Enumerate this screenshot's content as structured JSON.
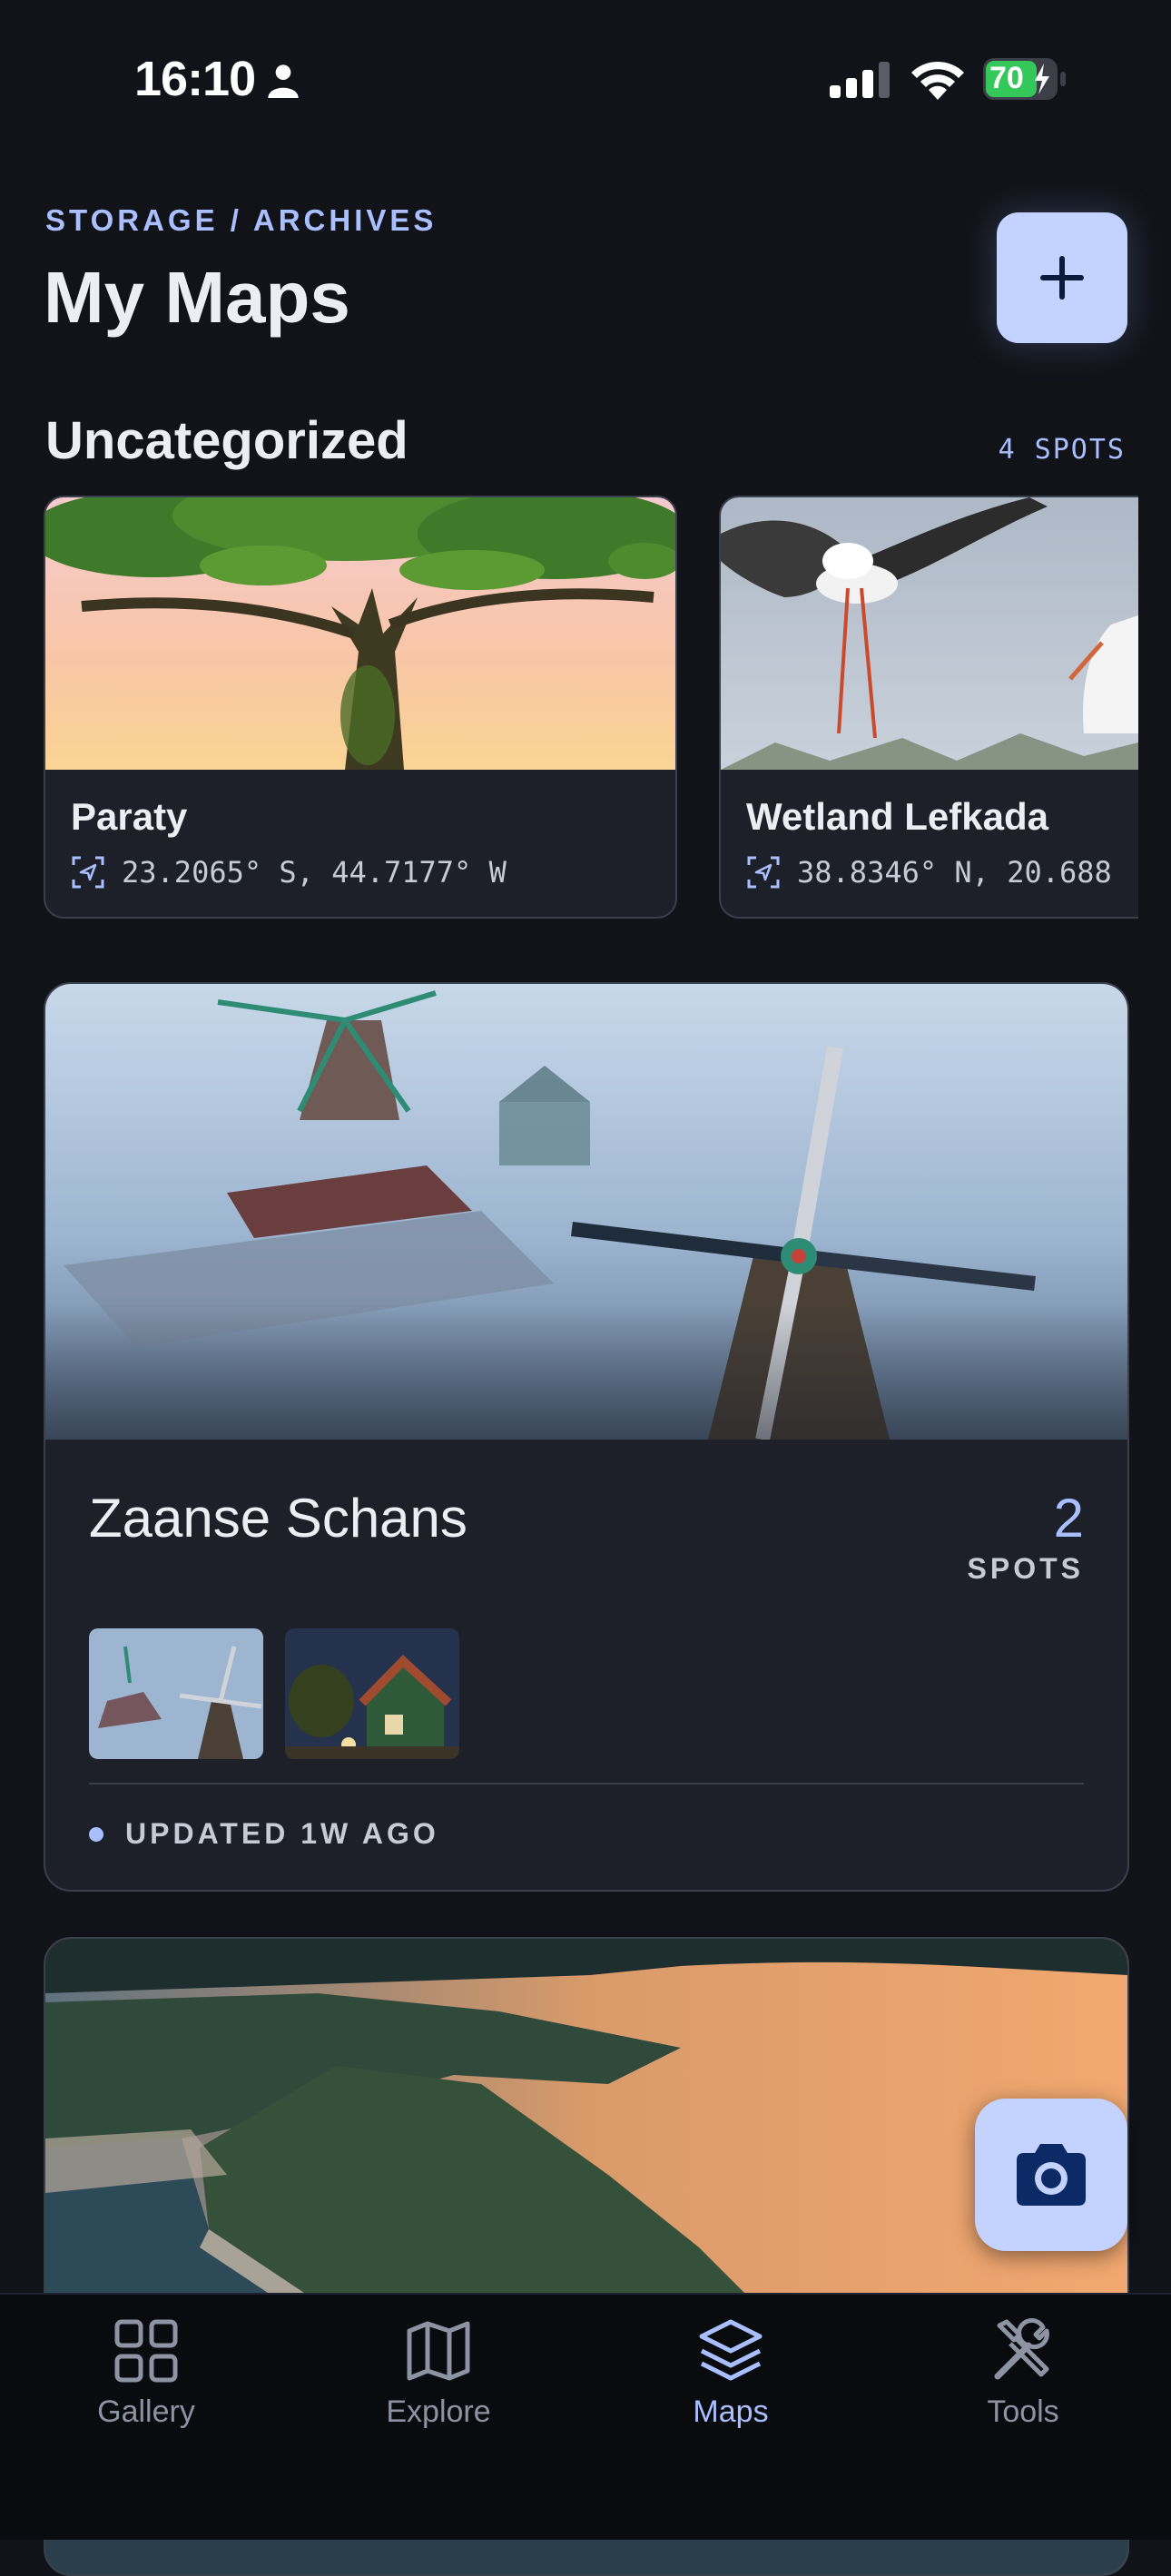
{
  "status_bar": {
    "time": "16:10",
    "battery": "70"
  },
  "header": {
    "breadcrumb": "STORAGE / ARCHIVES",
    "title": "My Maps",
    "add_icon": "plus-icon"
  },
  "uncategorized": {
    "title": "Uncategorized",
    "count": "4 SPOTS",
    "spots": [
      {
        "name": "Paraty",
        "coords": "23.2065° S, 44.7177° W",
        "icon": "location-icon"
      },
      {
        "name": "Wetland Lefkada",
        "coords": "38.8346° N, 20.688",
        "icon": "location-icon"
      }
    ]
  },
  "map_card": {
    "title": "Zaanse Schans",
    "count": "2",
    "count_label": "SPOTS",
    "updated": "UPDATED 1W AGO"
  },
  "nav": {
    "items": [
      {
        "label": "Gallery",
        "icon": "grid-icon",
        "active": false
      },
      {
        "label": "Explore",
        "icon": "map-icon",
        "active": false
      },
      {
        "label": "Maps",
        "icon": "layers-icon",
        "active": true
      },
      {
        "label": "Tools",
        "icon": "tools-icon",
        "active": false
      }
    ]
  },
  "colors": {
    "background": "#111319",
    "accent": "#A9BFFF",
    "button": "#C3D2FF",
    "card": "#1D2029"
  }
}
